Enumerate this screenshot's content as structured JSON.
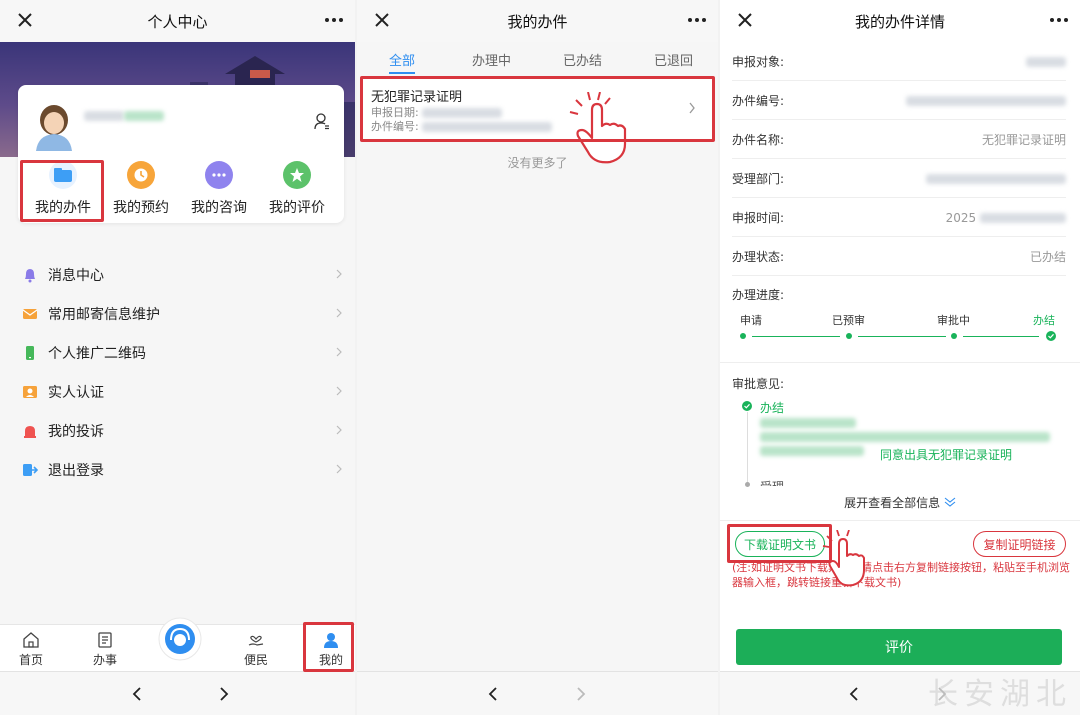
{
  "panel1": {
    "title": "个人中心",
    "quick_actions": [
      {
        "label": "我的办件",
        "icon": "folder-icon"
      },
      {
        "label": "我的预约",
        "icon": "clock-icon"
      },
      {
        "label": "我的咨询",
        "icon": "chat-icon"
      },
      {
        "label": "我的评价",
        "icon": "star-icon"
      }
    ],
    "menu": [
      {
        "label": "消息中心",
        "icon": "bell-icon"
      },
      {
        "label": "常用邮寄信息维护",
        "icon": "envelope-icon"
      },
      {
        "label": "个人推广二维码",
        "icon": "phone-icon"
      },
      {
        "label": "实人认证",
        "icon": "id-card-icon"
      },
      {
        "label": "我的投诉",
        "icon": "alarm-icon"
      },
      {
        "label": "退出登录",
        "icon": "logout-icon"
      }
    ],
    "tabs": [
      {
        "label": "首页",
        "icon": "home-icon"
      },
      {
        "label": "办事",
        "icon": "document-icon"
      },
      {
        "label": "便民",
        "icon": "hand-heart-icon"
      },
      {
        "label": "我的",
        "icon": "user-icon"
      }
    ]
  },
  "panel2": {
    "title": "我的办件",
    "tabs": [
      "全部",
      "办理中",
      "已办结",
      "已退回"
    ],
    "item": {
      "title": "无犯罪记录证明",
      "date_label": "申报日期:",
      "number_label": "办件编号:"
    },
    "empty_text": "没有更多了"
  },
  "panel3": {
    "title": "我的办件详情",
    "rows": [
      {
        "label": "申报对象:",
        "value": ""
      },
      {
        "label": "办件编号:",
        "value": ""
      },
      {
        "label": "办件名称:",
        "value": "无犯罪记录证明"
      },
      {
        "label": "受理部门:",
        "value": ""
      },
      {
        "label": "申报时间:",
        "value": "2025"
      },
      {
        "label": "办理状态:",
        "value": "已办结"
      }
    ],
    "progress_label": "办理进度:",
    "progress_steps": [
      "申请",
      "已预审",
      "审批中",
      "办结"
    ],
    "opinion_label": "审批意见:",
    "opinion_status": "办结",
    "opinion_text": "同意出具无犯罪记录证明",
    "opinion_next": "受理",
    "expand_text": "展开查看全部信息",
    "download_button": "下载证明文书",
    "copy_button": "复制证明链接",
    "note": "(注:如证明文书下载异常，请点击右方复制链接按钮，粘贴至手机浏览器输入框，跳转链接重新下载文书)",
    "evaluate_button": "评价",
    "watermark": "长安湖北"
  },
  "colors": {
    "accent_blue": "#2f8ef0",
    "green": "#1cae58",
    "red_highlight": "#d9363e"
  }
}
